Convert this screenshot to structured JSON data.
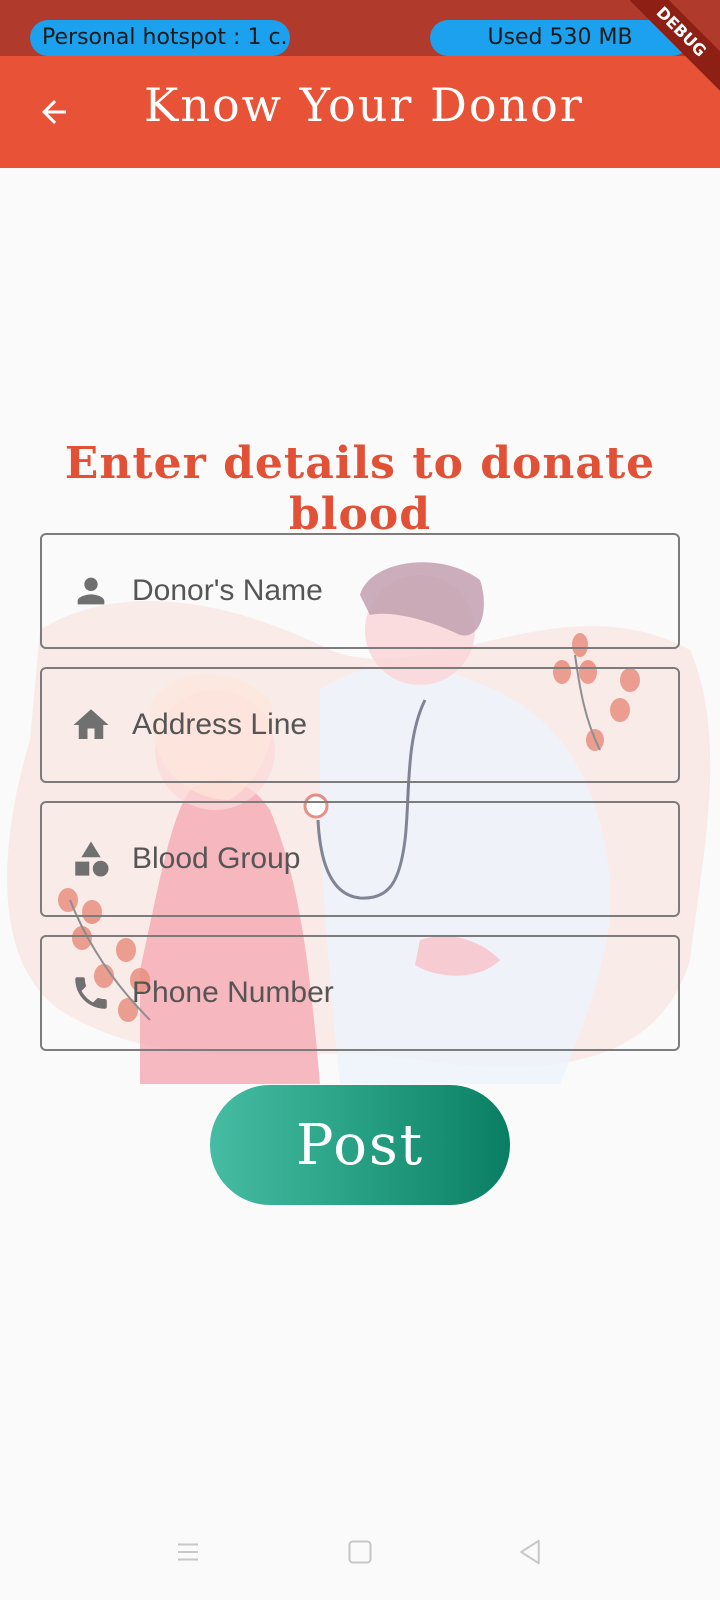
{
  "status_bar": {
    "hotspot_text": "Personal hotspot : 1 c...",
    "data_used_text": "Used  530 MB",
    "debug_ribbon": "DEBUG"
  },
  "app_bar": {
    "title": "Know Your Donor",
    "back_icon": "arrow-back-icon"
  },
  "form": {
    "heading": "Enter details to donate blood",
    "fields": [
      {
        "icon": "person-icon",
        "label": "Donor's Name"
      },
      {
        "icon": "home-icon",
        "label": "Address Line"
      },
      {
        "icon": "category-icon",
        "label": "Blood Group"
      },
      {
        "icon": "phone-icon",
        "label": "Phone Number"
      }
    ],
    "post_label": "Post"
  },
  "nav_bar": {
    "items": [
      "menu-icon",
      "home-square-icon",
      "back-triangle-icon"
    ]
  },
  "colors": {
    "status_bar": "#b03a2b",
    "app_bar": "#e85237",
    "accent": "#e25035",
    "button_start": "#46bca3",
    "button_end": "#0a7e63",
    "pill": "#1ba1ee"
  }
}
